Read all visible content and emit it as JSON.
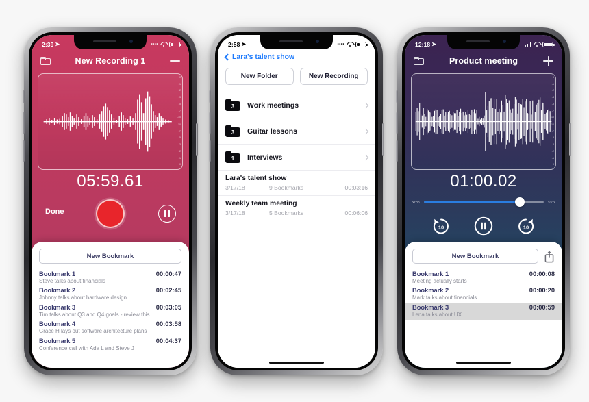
{
  "phone1": {
    "status": {
      "time": "2:39",
      "location_icon": "location-arrow-icon",
      "signal": "dots",
      "wifi": "wifi-icon",
      "battery": "battery-icon"
    },
    "nav": {
      "folder_icon": "folder-icon",
      "title": "New Recording 1",
      "add_icon": "plus-icon"
    },
    "waveform": {
      "db_labels_top": [
        "0",
        "-1",
        "-2",
        "-3",
        "-5",
        "-7",
        "-10"
      ],
      "db_labels_bottom": [
        "-10",
        "-7",
        "-5",
        "-3",
        "-2",
        "-1",
        "0"
      ]
    },
    "timer": "05:59.61",
    "controls": {
      "done_label": "Done",
      "record_icon": "record-button",
      "pause_icon": "pause-button"
    },
    "sheet": {
      "new_bookmark_label": "New Bookmark",
      "bookmarks": [
        {
          "title": "Bookmark 1",
          "time": "00:00:47",
          "note": "Steve talks about financials",
          "selected": false
        },
        {
          "title": "Bookmark 2",
          "time": "00:02:45",
          "note": "Johnny talks about hardware design",
          "selected": false
        },
        {
          "title": "Bookmark 3",
          "time": "00:03:05",
          "note": "Tim talks about Q3 and Q4 goals - review this",
          "selected": false
        },
        {
          "title": "Bookmark 4",
          "time": "00:03:58",
          "note": "Grace H lays out software architecture plans",
          "selected": false
        },
        {
          "title": "Bookmark 5",
          "time": "00:04:37",
          "note": "Conference call with Ada L and Steve J",
          "selected": false
        }
      ]
    }
  },
  "phone2": {
    "status": {
      "time": "2:58",
      "location_icon": "location-arrow-icon",
      "wifi": "wifi-icon",
      "battery": "battery-icon"
    },
    "back_label": "Lara's talent show",
    "buttons": {
      "new_folder": "New Folder",
      "new_recording": "New Recording"
    },
    "folders": [
      {
        "count": "3",
        "name": "Work meetings"
      },
      {
        "count": "3",
        "name": "Guitar lessons"
      },
      {
        "count": "1",
        "name": "Interviews"
      }
    ],
    "recordings": [
      {
        "name": "Lara's talent show",
        "date": "3/17/18",
        "bookmarks": "9 Bookmarks",
        "duration": "00:03:16"
      },
      {
        "name": "Weekly team meeting",
        "date": "3/17/18",
        "bookmarks": "5 Bookmarks",
        "duration": "00:06:06"
      }
    ]
  },
  "phone3": {
    "status": {
      "time": "12:18",
      "location_icon": "location-arrow-icon",
      "signal": "signal-bars-icon",
      "wifi": "wifi-icon",
      "battery": "battery-icon"
    },
    "nav": {
      "folder_icon": "folder-icon",
      "title": "Product meeting",
      "add_icon": "plus-icon"
    },
    "waveform": {
      "db_labels_top": [
        "0",
        "-1",
        "-2",
        "-3",
        "-5",
        "-7",
        "-10"
      ],
      "db_labels_bottom": [
        "-10",
        "-7",
        "-5",
        "-3",
        "-2",
        "-1",
        "0"
      ]
    },
    "timer": "01:00.02",
    "scrubber": {
      "elapsed": "00:00",
      "remaining": "1m7s",
      "progress_percent": 80
    },
    "transport": {
      "back_label": "10",
      "pause_icon": "pause-button",
      "forward_label": "10"
    },
    "sheet": {
      "new_bookmark_label": "New Bookmark",
      "share_icon": "share-icon",
      "bookmarks": [
        {
          "title": "Bookmark 1",
          "time": "00:00:08",
          "note": "Meeting actually starts",
          "selected": false
        },
        {
          "title": "Bookmark 2",
          "time": "00:00:20",
          "note": "Mark talks about financials",
          "selected": false
        },
        {
          "title": "Bookmark 3",
          "time": "00:00:59",
          "note": "Lena talks about UX",
          "selected": true
        }
      ]
    }
  },
  "colors": {
    "phone1_accent": "#bf3a5f",
    "phone3_top": "#3c2351",
    "phone3_bottom": "#17536e",
    "record_red": "#e8252b",
    "link_blue": "#1d7afc",
    "bookmark_title": "#3a3b6e"
  }
}
